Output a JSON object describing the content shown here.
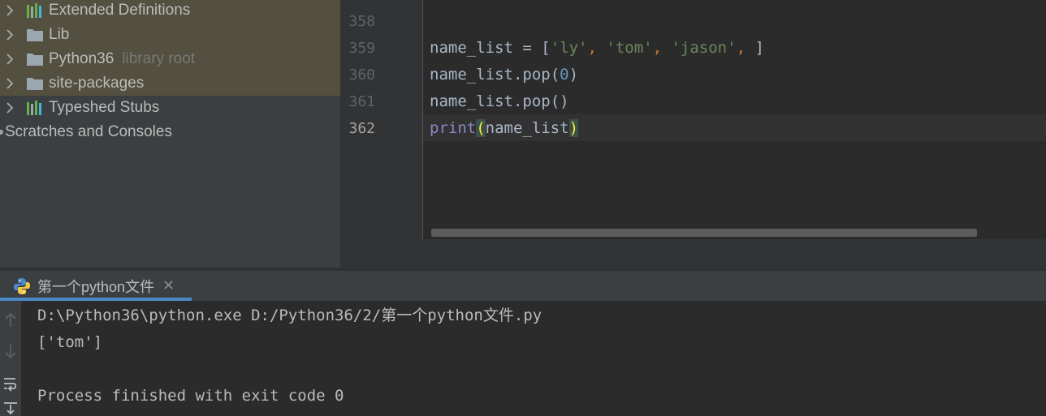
{
  "project_tree": {
    "items": [
      {
        "label": "Extended Definitions",
        "hint": "",
        "icon": "library-icon"
      },
      {
        "label": "Lib",
        "hint": "",
        "icon": "folder-icon"
      },
      {
        "label": "Python36",
        "hint": "library root",
        "icon": "folder-icon"
      },
      {
        "label": "site-packages",
        "hint": "",
        "icon": "folder-icon"
      },
      {
        "label": "Typeshed Stubs",
        "hint": "",
        "icon": "library-icon"
      },
      {
        "label": "Scratches and Consoles",
        "hint": "",
        "icon": "scratches-icon"
      }
    ]
  },
  "editor": {
    "line_numbers": [
      "358",
      "359",
      "360",
      "361",
      "362"
    ],
    "current_line": "362",
    "code": {
      "l359": {
        "var": "name_list",
        "op": " = ",
        "open": "[",
        "s1": "'ly'",
        "s2": "'tom'",
        "s3": "'jason'",
        "comma": ", ",
        "close": "]"
      },
      "l360": {
        "call": "name_list.pop(",
        "arg": "0",
        "end": ")"
      },
      "l361": {
        "call": "name_list.pop()"
      },
      "l362": {
        "fn": "print",
        "open": "(",
        "arg": "name_list",
        "close": ")"
      }
    }
  },
  "run_panel": {
    "tab_label": "第一个python文件",
    "close_icon": "close-icon",
    "console_lines": [
      "D:\\Python36\\python.exe D:/Python36/2/第一个python文件.py",
      "['tom']",
      "",
      "Process finished with exit code 0"
    ]
  },
  "colors": {
    "tree_selected": "#54503f",
    "keyword": "#cc7832",
    "string": "#6a8759",
    "number": "#6897bb",
    "builtin": "#8888c6",
    "tab_underline": "#4a88c7"
  }
}
